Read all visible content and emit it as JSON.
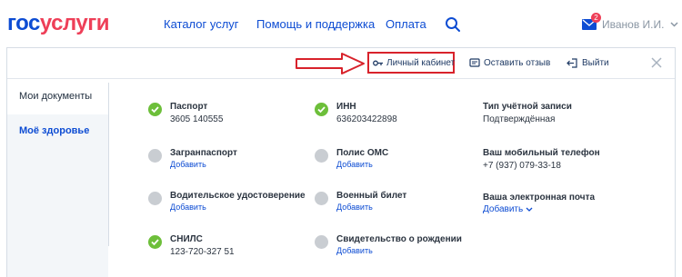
{
  "header": {
    "logo_part1": "гос",
    "logo_part2": "услуги",
    "nav": [
      "Каталог услуг",
      "Помощь и поддержка",
      "Оплата"
    ],
    "mail_count": "2",
    "user_name": "Иванов И.И."
  },
  "actions": {
    "personal_account": "Личный кабинет",
    "feedback": "Оставить отзыв",
    "logout": "Выйти"
  },
  "sidebar": {
    "items": [
      {
        "label": "Мои документы"
      },
      {
        "label": "Моё здоровье"
      }
    ]
  },
  "documents": {
    "column1": [
      {
        "title": "Паспорт",
        "value": "3605 140555",
        "status": "ok"
      },
      {
        "title": "Загранпаспорт",
        "link": "Добавить",
        "status": "none"
      },
      {
        "title": "Водительское удостоверение",
        "link": "Добавить",
        "status": "none"
      },
      {
        "title": "СНИЛС",
        "value": "123-720-327 51",
        "status": "ok"
      }
    ],
    "column2": [
      {
        "title": "ИНН",
        "value": "636203422898",
        "status": "ok"
      },
      {
        "title": "Полис ОМС",
        "link": "Добавить",
        "status": "none"
      },
      {
        "title": "Военный билет",
        "link": "Добавить",
        "status": "none"
      },
      {
        "title": "Свидетельство о рождении",
        "link": "Добавить",
        "status": "none"
      }
    ],
    "column3": [
      {
        "title": "Тип учётной записи",
        "value": "Подтверждённая"
      },
      {
        "title": "Ваш мобильный телефон",
        "value": "+7 (937) 079-33-18"
      },
      {
        "title": "Ваша электронная почта",
        "link": "Добавить"
      }
    ]
  },
  "colors": {
    "brand_blue": "#0d4cd3",
    "brand_red": "#ee3f58",
    "status_ok": "#6dbf3a",
    "status_none": "#c9cdd2",
    "highlight": "#d8222b"
  }
}
